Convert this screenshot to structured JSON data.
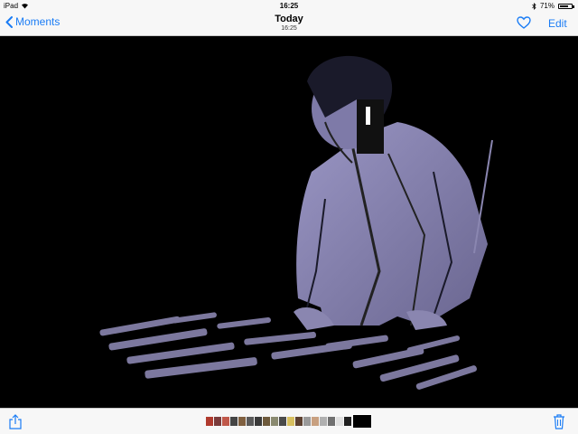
{
  "status": {
    "device": "iPad",
    "time": "16:25",
    "battery": "71%",
    "battery_level": 0.71
  },
  "nav": {
    "back_label": "Moments",
    "title": "Today",
    "subtitle": "16:25",
    "edit_label": "Edit"
  },
  "icons": {
    "back": "chevron-left-icon",
    "favorite": "heart-icon",
    "share": "share-icon",
    "delete": "trash-icon",
    "wifi": "wifi-icon",
    "bluetooth": "bluetooth-icon",
    "battery": "battery-icon"
  },
  "colors": {
    "accent": "#1a7cf5",
    "bars": "#f7f7f7",
    "photo_bg": "#000000",
    "figure": "#8a86b0"
  },
  "filmstrip": {
    "thumb_colors": [
      "#b03a2e",
      "#7a3b3b",
      "#c0584a",
      "#444",
      "#806040",
      "#5a5a5a",
      "#3a3a3a",
      "#6e5a3c",
      "#8a8a70",
      "#4a4a4a",
      "#d8c060",
      "#5c4030",
      "#9a9a9a",
      "#c8a080",
      "#b0b0b0",
      "#707070",
      "#e0e0e0",
      "#202020"
    ],
    "selected_index": 18
  }
}
